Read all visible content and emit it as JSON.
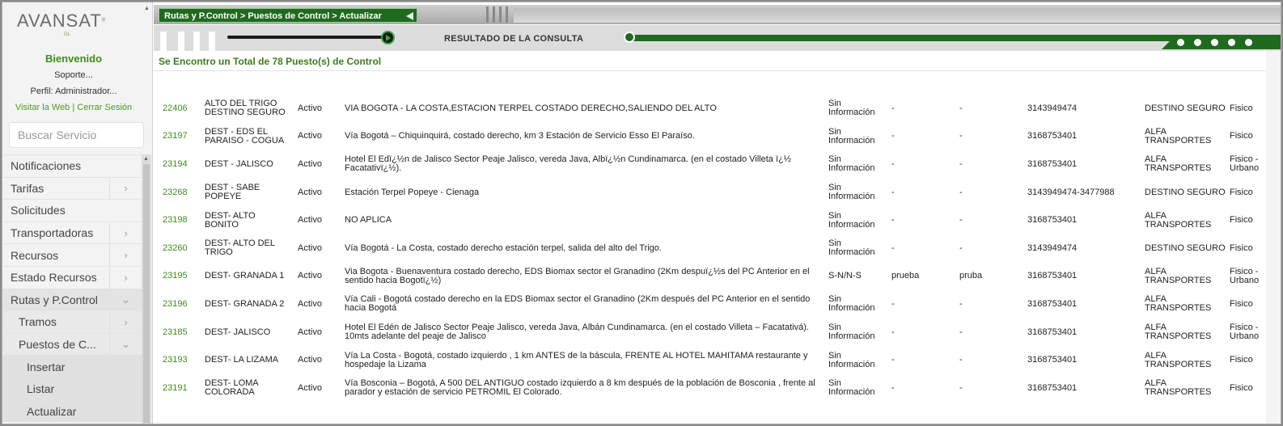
{
  "brand": {
    "logo_main": "AVANSAT",
    "logo_reg": "®",
    "logo_sub": "GL"
  },
  "user": {
    "welcome": "Bienvenido",
    "support": "Soporte...",
    "profile_label": "Perfil:",
    "profile_value": "Administrador...",
    "visit_web": "Visitar la Web",
    "separator": "|",
    "logout": "Cerrar Sesión"
  },
  "search": {
    "placeholder": "Buscar Servicio"
  },
  "menu": {
    "items": [
      {
        "label": "Notificaciones",
        "chevron": ""
      },
      {
        "label": "Tarifas",
        "chevron": "›"
      },
      {
        "label": "Solicitudes",
        "chevron": ""
      },
      {
        "label": "Transportadoras",
        "chevron": "›"
      },
      {
        "label": "Recursos",
        "chevron": "›"
      },
      {
        "label": "Estado Recursos",
        "chevron": "›"
      },
      {
        "label": "Rutas y P.Control",
        "chevron": "⌄"
      },
      {
        "label": "Tramos",
        "chevron": "›"
      },
      {
        "label": "Puestos de C...",
        "chevron": "⌄"
      },
      {
        "label": "Insertar",
        "chevron": ""
      },
      {
        "label": "Listar",
        "chevron": ""
      },
      {
        "label": "Actualizar",
        "chevron": ""
      }
    ]
  },
  "header": {
    "breadcrumb": "Rutas y P.Control > Puestos de Control > Actualizar",
    "result_label": "RESULTADO DE LA CONSULTA",
    "summary": "Se Encontro un Total de 78 Puesto(s) de Control"
  },
  "colors": {
    "accent": "#1f6a1f",
    "link": "#3f8b1e"
  },
  "table": {
    "rows": [
      {
        "id": "22406",
        "name": "ALTO DEL TRIGO DESTINO SEGURO",
        "state": "Activo",
        "address": "VIA BOGOTA - LA COSTA,ESTACION TERPEL COSTADO DERECHO,SALIENDO DEL ALTO",
        "info": "Sin Información",
        "a": "-",
        "b": "-",
        "phone": "3143949474",
        "dest": "DESTINO SEGURO",
        "type": "Fisico"
      },
      {
        "id": "23197",
        "name": "DEST - EDS EL PARAISO - COGUA",
        "state": "Activo",
        "address": "Vía Bogotá – Chiquinquirá, costado derecho, km 3 Estación de Servicio Esso El Paraíso.",
        "info": "Sin Información",
        "a": "-",
        "b": "-",
        "phone": "3168753401",
        "dest": "ALFA TRANSPORTES",
        "type": "Fisico"
      },
      {
        "id": "23194",
        "name": "DEST - JALISCO",
        "state": "Activo",
        "address": "Hotel El Edï¿½n de Jalisco Sector Peaje Jalisco, vereda Java, Albï¿½n Cundinamarca. (en el costado Villeta ï¿½ Facatativï¿½).",
        "info": "Sin Información",
        "a": "-",
        "b": "-",
        "phone": "3168753401",
        "dest": "ALFA TRANSPORTES",
        "type": "Fisico - Urbano"
      },
      {
        "id": "23268",
        "name": "DEST - SABE POPEYE",
        "state": "Activo",
        "address": "Estación Terpel Popeye - Cienaga",
        "info": "Sin Información",
        "a": "-",
        "b": "-",
        "phone": "3143949474-3477988",
        "dest": "DESTINO SEGURO",
        "type": "Fisico"
      },
      {
        "id": "23198",
        "name": "DEST- ALTO BONITO",
        "state": "Activo",
        "address": "NO APLICA",
        "info": "Sin Información",
        "a": "-",
        "b": "-",
        "phone": "3168753401",
        "dest": "ALFA TRANSPORTES",
        "type": "Fisico"
      },
      {
        "id": "23260",
        "name": "DEST- ALTO DEL TRIGO",
        "state": "Activo",
        "address": "Vía Bogotá - La Costa, costado derecho estación terpel, salida del alto del Trigo.",
        "info": "Sin Información",
        "a": "-",
        "b": "-",
        "phone": "3143949474",
        "dest": "DESTINO SEGURO",
        "type": "Fisico"
      },
      {
        "id": "23195",
        "name": "DEST- GRANADA 1",
        "state": "Activo",
        "address": "Via Bogota - Buenaventura costado derecho, EDS Biomax sector el Granadino (2Km despuï¿½s del PC Anterior en el sentido hacia Bogotï¿½)",
        "info": "S-N/N-S",
        "a": "prueba",
        "b": "pruba",
        "phone": "3168753401",
        "dest": "ALFA TRANSPORTES",
        "type": "Fisico - Urbano"
      },
      {
        "id": "23196",
        "name": "DEST- GRANADA 2",
        "state": "Activo",
        "address": "Vía Cali - Bogotá costado derecho en la EDS Biomax sector el Granadino (2Km después del PC Anterior en el sentido hacia Bogotá",
        "info": "Sin Información",
        "a": "-",
        "b": "-",
        "phone": "3168753401",
        "dest": "ALFA TRANSPORTES",
        "type": "Fisico"
      },
      {
        "id": "23185",
        "name": "DEST- JALISCO",
        "state": "Activo",
        "address": "Hotel El Edén de Jalisco Sector Peaje Jalisco, vereda Java, Albán Cundinamarca. (en el costado Villeta – Facatativá). 10mts adelante del peaje de Jalisco",
        "info": "Sin Información",
        "a": "-",
        "b": "-",
        "phone": "3168753401",
        "dest": "ALFA TRANSPORTES",
        "type": "Fisico - Urbano"
      },
      {
        "id": "23193",
        "name": "DEST- LA LIZAMA",
        "state": "Activo",
        "address": "Vía La Costa - Bogotá, costado izquierdo , 1 km ANTES de la báscula, FRENTE AL HOTEL MAHITAMA restaurante y hospedaje la Lizama",
        "info": "Sin Información",
        "a": "-",
        "b": "-",
        "phone": "3168753401",
        "dest": "ALFA TRANSPORTES",
        "type": "Fisico"
      },
      {
        "id": "23191",
        "name": "DEST- LOMA COLORADA",
        "state": "Activo",
        "address": "Vía Bosconia – Bogotá, A 500 DEL ANTIGUO costado izquierdo a 8 km después de la población de Bosconia , frente al parador y estación de servicio PETROMIL El Colorado.",
        "info": "Sin Información",
        "a": "-",
        "b": "-",
        "phone": "3168753401",
        "dest": "ALFA TRANSPORTES",
        "type": "Fisico"
      }
    ]
  }
}
